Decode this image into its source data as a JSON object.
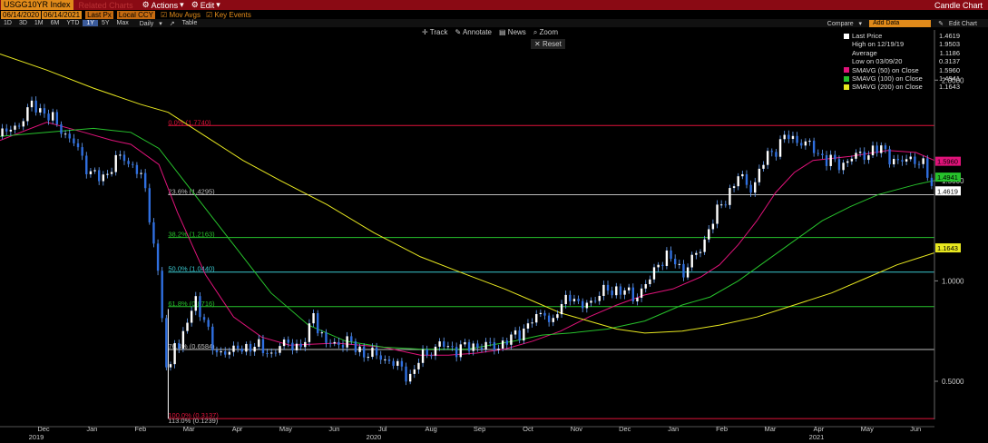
{
  "topbar": {
    "ticker": "USGG10YR Index",
    "dim_label": "Related Charts",
    "actions": "Actions",
    "edit": "Edit",
    "title": "Candle Chart"
  },
  "settings": {
    "start": "06/14/2020",
    "end": "06/14/2021",
    "field": "Last Px",
    "currency": "Local CCY",
    "mov_avgs": "Mov Avgs",
    "key_events": "Key Events"
  },
  "periods": [
    "1D",
    "3D",
    "1M",
    "6M",
    "YTD",
    "1Y",
    "5Y",
    "Max"
  ],
  "period_selected": "1Y",
  "frequency": "Daily",
  "table_label": "Table",
  "compare_label": "Compare",
  "add_data": "Add Data",
  "edit_chart": "Edit Chart",
  "tools": {
    "track": "Track",
    "annotate": "Annotate",
    "news": "News",
    "zoom": "Zoom",
    "reset": "Reset"
  },
  "legend": {
    "last_price": {
      "label": "Last Price",
      "value": "1.4619",
      "color": "#ffffff"
    },
    "high": {
      "label": "High on 12/19/19",
      "value": "1.9503"
    },
    "average": {
      "label": "Average",
      "value": "1.1186"
    },
    "low": {
      "label": "Low on 03/09/20",
      "value": "0.3137"
    },
    "sma50": {
      "label": "SMAVG (50)  on Close",
      "value": "1.5960",
      "color": "#e0137a"
    },
    "sma100": {
      "label": "SMAVG (100)  on Close",
      "value": "1.4941",
      "color": "#27c22c"
    },
    "sma200": {
      "label": "SMAVG (200)  on Close",
      "value": "1.1643",
      "color": "#e8e820"
    }
  },
  "chart_data": {
    "type": "line",
    "ylim": [
      0.31,
      2.25
    ],
    "yticks": [
      0.5,
      1.0,
      1.5,
      2.0
    ],
    "ytick_labels": [
      "0.5000",
      "1.0000",
      "1.5000",
      "2.0000"
    ],
    "months": [
      "Dec",
      "Jan",
      "Feb",
      "Mar",
      "Apr",
      "May",
      "Jun",
      "Jul",
      "Aug",
      "Sep",
      "Oct",
      "Nov",
      "Dec",
      "Jan",
      "Feb",
      "Mar",
      "Apr",
      "May",
      "Jun"
    ],
    "years": [
      "2019",
      "2020",
      "2021"
    ],
    "price_path": [
      [
        0,
        1.72
      ],
      [
        4,
        1.78
      ],
      [
        7,
        1.88
      ],
      [
        10,
        1.83
      ],
      [
        13,
        1.76
      ],
      [
        16,
        1.68
      ],
      [
        19,
        1.55
      ],
      [
        22,
        1.5
      ],
      [
        25,
        1.62
      ],
      [
        28,
        1.58
      ],
      [
        30,
        1.55
      ],
      [
        32,
        1.32
      ],
      [
        34,
        1.02
      ],
      [
        35.3,
        0.68
      ],
      [
        36,
        0.36
      ],
      [
        36.3,
        0.5
      ],
      [
        37,
        0.74
      ],
      [
        38,
        0.66
      ],
      [
        40,
        0.79
      ],
      [
        42,
        0.9
      ],
      [
        44,
        0.8
      ],
      [
        46,
        0.62
      ],
      [
        48,
        0.66
      ],
      [
        50,
        0.65
      ],
      [
        54,
        0.68
      ],
      [
        58,
        0.64
      ],
      [
        62,
        0.7
      ],
      [
        64,
        0.66
      ],
      [
        66,
        0.72
      ],
      [
        67,
        0.88
      ],
      [
        68,
        0.76
      ],
      [
        70,
        0.68
      ],
      [
        74,
        0.7
      ],
      [
        78,
        0.64
      ],
      [
        82,
        0.62
      ],
      [
        86,
        0.56
      ],
      [
        88,
        0.52
      ],
      [
        90,
        0.62
      ],
      [
        94,
        0.68
      ],
      [
        98,
        0.66
      ],
      [
        102,
        0.68
      ],
      [
        106,
        0.67
      ],
      [
        110,
        0.72
      ],
      [
        114,
        0.8
      ],
      [
        117,
        0.86
      ],
      [
        118,
        0.76
      ],
      [
        120,
        0.88
      ],
      [
        122,
        0.94
      ],
      [
        124,
        0.86
      ],
      [
        126,
        0.9
      ],
      [
        128,
        0.92
      ],
      [
        130,
        0.96
      ],
      [
        133,
        0.95
      ],
      [
        136,
        0.92
      ],
      [
        139,
        1.0
      ],
      [
        141,
        1.1
      ],
      [
        143,
        1.12
      ],
      [
        145,
        1.08
      ],
      [
        146,
        1.04
      ],
      [
        148,
        1.1
      ],
      [
        150,
        1.16
      ],
      [
        152,
        1.28
      ],
      [
        155,
        1.4
      ],
      [
        158,
        1.52
      ],
      [
        161,
        1.46
      ],
      [
        164,
        1.62
      ],
      [
        167,
        1.68
      ],
      [
        168,
        1.72
      ],
      [
        171,
        1.7
      ],
      [
        174,
        1.66
      ],
      [
        177,
        1.6
      ],
      [
        180,
        1.58
      ],
      [
        183,
        1.62
      ],
      [
        186,
        1.64
      ],
      [
        189,
        1.66
      ],
      [
        192,
        1.58
      ],
      [
        195,
        1.62
      ],
      [
        198,
        1.56
      ],
      [
        199,
        1.5
      ],
      [
        200,
        1.46
      ]
    ],
    "series": [
      {
        "name": "Last Price",
        "last": 1.4619,
        "high": 1.9503,
        "average": 1.1186,
        "low": 0.3137
      },
      {
        "name": "SMAVG (50)",
        "last": 1.596,
        "path": [
          [
            0,
            1.7
          ],
          [
            10,
            1.79
          ],
          [
            18,
            1.74
          ],
          [
            24,
            1.7
          ],
          [
            28,
            1.68
          ],
          [
            34,
            1.58
          ],
          [
            38,
            1.34
          ],
          [
            44,
            1.03
          ],
          [
            50,
            0.82
          ],
          [
            56,
            0.72
          ],
          [
            62,
            0.68
          ],
          [
            72,
            0.69
          ],
          [
            82,
            0.67
          ],
          [
            90,
            0.63
          ],
          [
            96,
            0.63
          ],
          [
            102,
            0.64
          ],
          [
            108,
            0.66
          ],
          [
            114,
            0.7
          ],
          [
            120,
            0.75
          ],
          [
            126,
            0.82
          ],
          [
            132,
            0.88
          ],
          [
            138,
            0.93
          ],
          [
            144,
            0.96
          ],
          [
            150,
            1.02
          ],
          [
            154,
            1.08
          ],
          [
            158,
            1.18
          ],
          [
            162,
            1.3
          ],
          [
            166,
            1.44
          ],
          [
            170,
            1.54
          ],
          [
            174,
            1.6
          ],
          [
            182,
            1.62
          ],
          [
            190,
            1.65
          ],
          [
            196,
            1.64
          ],
          [
            200,
            1.6
          ]
        ]
      },
      {
        "name": "SMAVG (100)",
        "last": 1.4941,
        "path": [
          [
            0,
            1.72
          ],
          [
            10,
            1.74
          ],
          [
            20,
            1.76
          ],
          [
            28,
            1.74
          ],
          [
            34,
            1.66
          ],
          [
            40,
            1.48
          ],
          [
            50,
            1.18
          ],
          [
            58,
            0.94
          ],
          [
            66,
            0.78
          ],
          [
            74,
            0.7
          ],
          [
            82,
            0.67
          ],
          [
            90,
            0.66
          ],
          [
            100,
            0.66
          ],
          [
            110,
            0.7
          ],
          [
            116,
            0.73
          ],
          [
            122,
            0.74
          ],
          [
            130,
            0.76
          ],
          [
            138,
            0.8
          ],
          [
            146,
            0.88
          ],
          [
            152,
            0.92
          ],
          [
            158,
            1.0
          ],
          [
            164,
            1.1
          ],
          [
            170,
            1.2
          ],
          [
            176,
            1.3
          ],
          [
            182,
            1.37
          ],
          [
            188,
            1.43
          ],
          [
            196,
            1.48
          ],
          [
            200,
            1.5
          ]
        ]
      },
      {
        "name": "SMAVG (200)",
        "last": 1.1643,
        "path": [
          [
            0,
            2.13
          ],
          [
            10,
            2.05
          ],
          [
            20,
            1.96
          ],
          [
            30,
            1.88
          ],
          [
            36,
            1.84
          ],
          [
            44,
            1.72
          ],
          [
            52,
            1.6
          ],
          [
            60,
            1.5
          ],
          [
            70,
            1.38
          ],
          [
            80,
            1.24
          ],
          [
            90,
            1.12
          ],
          [
            100,
            1.03
          ],
          [
            108,
            0.96
          ],
          [
            114,
            0.9
          ],
          [
            120,
            0.84
          ],
          [
            126,
            0.8
          ],
          [
            132,
            0.76
          ],
          [
            138,
            0.74
          ],
          [
            146,
            0.75
          ],
          [
            154,
            0.78
          ],
          [
            162,
            0.82
          ],
          [
            170,
            0.88
          ],
          [
            178,
            0.94
          ],
          [
            186,
            1.02
          ],
          [
            192,
            1.08
          ],
          [
            200,
            1.14
          ]
        ]
      }
    ],
    "fibonacci": [
      {
        "label": "0.0% (1.7740)",
        "value": 1.774,
        "color": "#e0133a"
      },
      {
        "label": "23.6% (1.4295)",
        "value": 1.4295,
        "color": "#bbbbbb"
      },
      {
        "label": "38.2% (1.2163)",
        "value": 1.2163,
        "color": "#27c22c"
      },
      {
        "label": "50.0% (1.0440)",
        "value": 1.044,
        "color": "#3ac8d0"
      },
      {
        "label": "61.8% (0.8716)",
        "value": 0.8716,
        "color": "#27c22c"
      },
      {
        "label": "76.4% (0.6584)",
        "value": 0.6584,
        "color": "#bbbbbb"
      },
      {
        "label": "100.0% (0.3137)",
        "value": 0.3137,
        "color": "#e0133a"
      },
      {
        "label": "113.0% (0.1239)",
        "value": 0.1239,
        "color": "#bbbbbb"
      }
    ],
    "grid": false,
    "legend_position": "top-right"
  }
}
